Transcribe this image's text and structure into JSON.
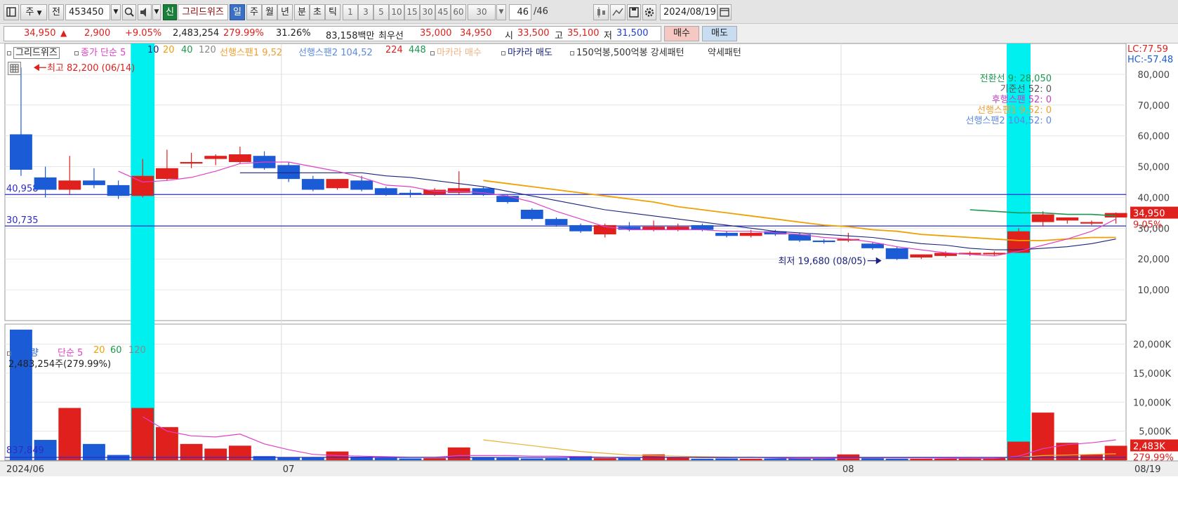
{
  "toolbar": {
    "type_select": "주",
    "prev_label": "전",
    "stock_code": "453450",
    "sin_label": "신",
    "gridwiz_label": "그리드위즈",
    "periods": [
      "일",
      "주",
      "월",
      "년"
    ],
    "intervals": [
      "분",
      "초",
      "틱"
    ],
    "interval_values": [
      "1",
      "3",
      "5",
      "10",
      "15",
      "30",
      "45",
      "60"
    ],
    "interval_select": "30",
    "count": "46",
    "count_total": "/46",
    "date": "2024/08/19"
  },
  "quote": {
    "price": "34,950",
    "up_arrow": "▲",
    "change": "2,900",
    "change_pct": "+9.05%",
    "volume": "2,483,254",
    "volume_ratio": "279.99%",
    "turnover": "31.26%",
    "amount": "83,158백만",
    "priority_label": "최우선",
    "ask": "35,000",
    "bid": "34,950",
    "open_label": "시",
    "open": "33,500",
    "high_label": "고",
    "high": "35,100",
    "low_label": "저",
    "low": "31,500",
    "buy_label": "매수",
    "sell_label": "매도"
  },
  "legend": {
    "gridwiz": "그리드위즈",
    "ma_label": "종가 단순 5",
    "ma10": "10",
    "ma20": "20",
    "ma40": "40",
    "ma120": "120",
    "span1": "선행스팬1 9,52",
    "span2": "선행스팬2 104,52",
    "n224": "224",
    "n448": "448",
    "macara_buy": "마카라 매수",
    "macara_sell": "마카라 매도",
    "pattern": "150억봉,500억봉 강세패턴",
    "weak": "약세패턴"
  },
  "ichimoku_labels": {
    "conv": "전환선 9: 28,050",
    "base": "기준선 52: 0",
    "lag": "후행스팬 52: 0",
    "lead1": "선행스팬1 9,52: 0",
    "lead2": "선행스팬2 104,52: 0"
  },
  "right_top": {
    "lc": "LC:77.59",
    "hc": "HC:-57.48"
  },
  "volume_legend": {
    "label": "거래량",
    "ma_label": "단순 5",
    "ma20": "20",
    "ma60": "60",
    "ma120": "120",
    "current": "2,483,254주(279.99%)",
    "last_tag": "2,483K",
    "last_pct": "279.99%",
    "left_low_label": "837,849"
  },
  "colors": {
    "up": "#e0201c",
    "down": "#1c5bd6",
    "highlight": "#00f0f0",
    "ma5": "#e040c8",
    "ma10": "#1a237e",
    "span1": "#f0a000",
    "conv": "#1a9850",
    "hline": "#2c2cc8"
  },
  "chart_data": [
    {
      "type": "candlestick",
      "x_labels": [
        "2024/06",
        "07",
        "08",
        "08/19"
      ],
      "ylim": [
        0,
        90000
      ],
      "y_ticks": [
        10000,
        20000,
        30000,
        40000,
        50000,
        60000,
        70000,
        80000
      ],
      "y_tick_labels": [
        "10,000",
        "20,000",
        "30,000",
        "40,000",
        "50,000",
        "60,000",
        "70,000",
        "80,000"
      ],
      "candles": [
        {
          "o": 60500,
          "h": 82200,
          "l": 47000,
          "c": 49000
        },
        {
          "o": 46500,
          "h": 50000,
          "l": 40000,
          "c": 42500
        },
        {
          "o": 42500,
          "h": 53500,
          "l": 41000,
          "c": 45500
        },
        {
          "o": 45500,
          "h": 49500,
          "l": 43000,
          "c": 44000
        },
        {
          "o": 44000,
          "h": 45500,
          "l": 39500,
          "c": 40500
        },
        {
          "o": 40500,
          "h": 52500,
          "l": 40000,
          "c": 47000
        },
        {
          "o": 46000,
          "h": 55500,
          "l": 45500,
          "c": 49500
        },
        {
          "o": 51000,
          "h": 54500,
          "l": 49500,
          "c": 51500
        },
        {
          "o": 52500,
          "h": 54000,
          "l": 50500,
          "c": 53500
        },
        {
          "o": 51500,
          "h": 56500,
          "l": 51000,
          "c": 54000
        },
        {
          "o": 53500,
          "h": 55000,
          "l": 49000,
          "c": 49500
        },
        {
          "o": 50500,
          "h": 51500,
          "l": 45000,
          "c": 46000
        },
        {
          "o": 46000,
          "h": 47000,
          "l": 42000,
          "c": 42500
        },
        {
          "o": 43000,
          "h": 46000,
          "l": 42500,
          "c": 46000
        },
        {
          "o": 45500,
          "h": 47000,
          "l": 42000,
          "c": 42500
        },
        {
          "o": 43000,
          "h": 43500,
          "l": 40500,
          "c": 41000
        },
        {
          "o": 41500,
          "h": 42500,
          "l": 40000,
          "c": 41000
        },
        {
          "o": 41000,
          "h": 43000,
          "l": 40500,
          "c": 42500
        },
        {
          "o": 41500,
          "h": 48500,
          "l": 41000,
          "c": 43000
        },
        {
          "o": 43000,
          "h": 43500,
          "l": 40500,
          "c": 41000
        },
        {
          "o": 40500,
          "h": 41000,
          "l": 38000,
          "c": 38500
        },
        {
          "o": 36000,
          "h": 36500,
          "l": 32500,
          "c": 33000
        },
        {
          "o": 33000,
          "h": 33500,
          "l": 30500,
          "c": 31000
        },
        {
          "o": 31000,
          "h": 31500,
          "l": 28500,
          "c": 29000
        },
        {
          "o": 28000,
          "h": 31500,
          "l": 27000,
          "c": 31000
        },
        {
          "o": 30500,
          "h": 32000,
          "l": 29000,
          "c": 29500
        },
        {
          "o": 29500,
          "h": 32500,
          "l": 29000,
          "c": 30500
        },
        {
          "o": 29500,
          "h": 31500,
          "l": 29000,
          "c": 30500
        },
        {
          "o": 31000,
          "h": 31500,
          "l": 29000,
          "c": 29500
        },
        {
          "o": 28500,
          "h": 29000,
          "l": 27000,
          "c": 27500
        },
        {
          "o": 27500,
          "h": 29500,
          "l": 27000,
          "c": 28500
        },
        {
          "o": 29000,
          "h": 29500,
          "l": 27500,
          "c": 28000
        },
        {
          "o": 28000,
          "h": 28500,
          "l": 25500,
          "c": 26000
        },
        {
          "o": 26000,
          "h": 26500,
          "l": 25000,
          "c": 25500
        },
        {
          "o": 26000,
          "h": 28500,
          "l": 25500,
          "c": 26500
        },
        {
          "o": 25000,
          "h": 25500,
          "l": 23000,
          "c": 23500
        },
        {
          "o": 23500,
          "h": 24000,
          "l": 19680,
          "c": 20000
        },
        {
          "o": 20500,
          "h": 21500,
          "l": 20000,
          "c": 21500
        },
        {
          "o": 21000,
          "h": 22500,
          "l": 20500,
          "c": 22000
        },
        {
          "o": 21500,
          "h": 22500,
          "l": 21000,
          "c": 22000
        },
        {
          "o": 21500,
          "h": 22500,
          "l": 21000,
          "c": 22000
        },
        {
          "o": 22000,
          "h": 30000,
          "l": 22000,
          "c": 29000
        },
        {
          "o": 32000,
          "h": 35500,
          "l": 30500,
          "c": 34500
        },
        {
          "o": 32500,
          "h": 33500,
          "l": 31500,
          "c": 33500
        },
        {
          "o": 31500,
          "h": 32500,
          "l": 31000,
          "c": 32000
        },
        {
          "o": 33500,
          "h": 35100,
          "l": 31500,
          "c": 34950
        }
      ],
      "highlight_bars": [
        5,
        41
      ],
      "hlines": [
        {
          "value": 40958,
          "label": "40,958"
        },
        {
          "value": 30735,
          "label": "30,735"
        }
      ],
      "annotations": [
        {
          "text": "최고 82,200 (06/14)",
          "bar": 0,
          "value": 82200
        },
        {
          "text": "최저 19,680 (08/05)",
          "bar": 36,
          "value": 19680
        }
      ],
      "price_tag": "34,950",
      "price_tag_pct": "9.05%",
      "ma5": [
        null,
        null,
        null,
        null,
        48500,
        45000,
        45500,
        46500,
        48500,
        51000,
        51500,
        51500,
        50000,
        48500,
        46500,
        44000,
        43500,
        42000,
        42000,
        41500,
        40500,
        38500,
        35500,
        33000,
        30500,
        29500,
        29500,
        29500,
        29500,
        29000,
        29000,
        28500,
        28000,
        27000,
        26500,
        25500,
        24000,
        23000,
        22000,
        21500,
        21000,
        22500,
        24500,
        26500,
        29000,
        33000
      ],
      "ma10": [
        null,
        null,
        null,
        null,
        null,
        null,
        null,
        null,
        null,
        48000,
        48000,
        48000,
        48000,
        48000,
        48000,
        47000,
        46500,
        45500,
        44500,
        43500,
        42000,
        40500,
        39000,
        37500,
        36000,
        35000,
        34000,
        33000,
        32000,
        31000,
        30000,
        29000,
        28500,
        28000,
        27500,
        27000,
        26000,
        25000,
        24500,
        23500,
        23000,
        23000,
        23500,
        24000,
        25000,
        26500
      ],
      "span1": [
        null,
        null,
        null,
        null,
        null,
        null,
        null,
        null,
        null,
        null,
        null,
        null,
        null,
        null,
        null,
        null,
        null,
        null,
        null,
        45500,
        44500,
        43500,
        42500,
        41500,
        40500,
        39500,
        38500,
        37000,
        36000,
        35000,
        34000,
        33000,
        32000,
        31000,
        30500,
        29500,
        29000,
        28000,
        27500,
        27000,
        26500,
        26000,
        26000,
        26500,
        27000,
        27000
      ],
      "conv": [
        null,
        null,
        null,
        null,
        null,
        null,
        null,
        null,
        null,
        null,
        null,
        null,
        null,
        null,
        null,
        null,
        null,
        null,
        null,
        null,
        null,
        null,
        null,
        null,
        null,
        null,
        null,
        null,
        null,
        null,
        null,
        null,
        null,
        null,
        null,
        null,
        null,
        null,
        null,
        36000,
        35500,
        35000,
        35000,
        34500,
        34500,
        34000
      ]
    },
    {
      "type": "bar",
      "title": "거래량",
      "ylim": [
        0,
        22000
      ],
      "y_ticks": [
        5000,
        10000,
        15000,
        20000
      ],
      "y_tick_labels": [
        "5,000K",
        "10,000K",
        "15,000K",
        "20,000K"
      ],
      "values": [
        22500,
        3500,
        9000,
        2800,
        900,
        9000,
        5700,
        2800,
        2000,
        2500,
        700,
        500,
        450,
        1500,
        600,
        400,
        300,
        350,
        2200,
        500,
        400,
        300,
        350,
        700,
        350,
        400,
        1000,
        500,
        250,
        300,
        250,
        300,
        300,
        300,
        1000,
        350,
        250,
        250,
        250,
        350,
        400,
        3200,
        8200,
        3000,
        1000,
        2483
      ],
      "vol_ma": [
        null,
        null,
        null,
        null,
        null,
        7500,
        5000,
        4200,
        4000,
        4500,
        2800,
        1800,
        1000,
        800,
        700,
        600,
        500,
        500,
        800,
        800,
        800,
        700,
        700,
        600,
        500,
        400,
        500,
        500,
        450,
        450,
        500,
        400,
        300,
        300,
        400,
        450,
        400,
        400,
        350,
        300,
        300,
        700,
        2000,
        2700,
        3000,
        3500
      ],
      "vol_ma20": [
        null,
        null,
        null,
        null,
        null,
        null,
        null,
        null,
        null,
        null,
        null,
        null,
        null,
        null,
        null,
        null,
        null,
        null,
        null,
        3500,
        3000,
        2500,
        2000,
        1500,
        1200,
        900,
        800,
        700,
        600,
        550,
        500,
        450,
        450,
        400,
        400,
        400,
        400,
        400,
        400,
        400,
        400,
        500,
        800,
        900,
        1000,
        1100
      ]
    }
  ]
}
